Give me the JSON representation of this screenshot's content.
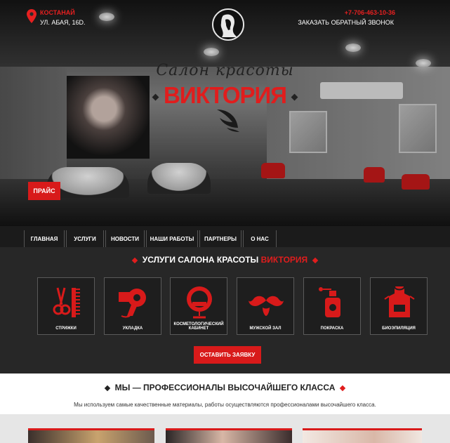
{
  "header": {
    "city": "КОСТАНАЙ",
    "address": "УЛ. АБАЯ, 16D.",
    "phone": "+7-706-463-10-36",
    "callback": "ЗАКАЗАТЬ ОБРАТНЫЙ ЗВОНОК"
  },
  "hero": {
    "script": "Салон красоты",
    "brand": "ВИКТОРИЯ",
    "price_button": "ПРАЙС"
  },
  "nav": {
    "items": [
      "ГЛАВНАЯ",
      "УСЛУГИ",
      "НОВОСТИ",
      "НАШИ РАБОТЫ",
      "ПАРТНЕРЫ",
      "О НАС"
    ]
  },
  "services": {
    "title": "УСЛУГИ САЛОНА КРАСОТЫ",
    "title_brand": "ВИКТОРИЯ",
    "items": [
      {
        "label": "СТРИЖКИ",
        "icon": "scissors-comb-icon"
      },
      {
        "label": "УКЛАДКА",
        "icon": "hair-dryer-icon"
      },
      {
        "label": "КОСМЕТОЛОГИЧЕСКИЙ КАБИНЕТ",
        "icon": "ball-chair-icon"
      },
      {
        "label": "МУЖСКОЙ ЗАЛ",
        "icon": "mustache-icon"
      },
      {
        "label": "ПОКРАСКА",
        "icon": "spray-bottle-icon"
      },
      {
        "label": "БИОЭПИЛЯЦИЯ",
        "icon": "apron-icon"
      }
    ],
    "order_button": "ОСТАВИТЬ ЗАЯВКУ"
  },
  "about": {
    "title": "МЫ — ПРОФЕССИОНАЛЫ ВЫСОЧАЙШЕГО КЛАССА",
    "text": "Мы используем самые качественные материалы, работы осуществляются профессионалами высочайшего класса."
  },
  "colors": {
    "accent": "#d81a1a",
    "dark": "#272727",
    "nav": "#1b1b1b"
  }
}
